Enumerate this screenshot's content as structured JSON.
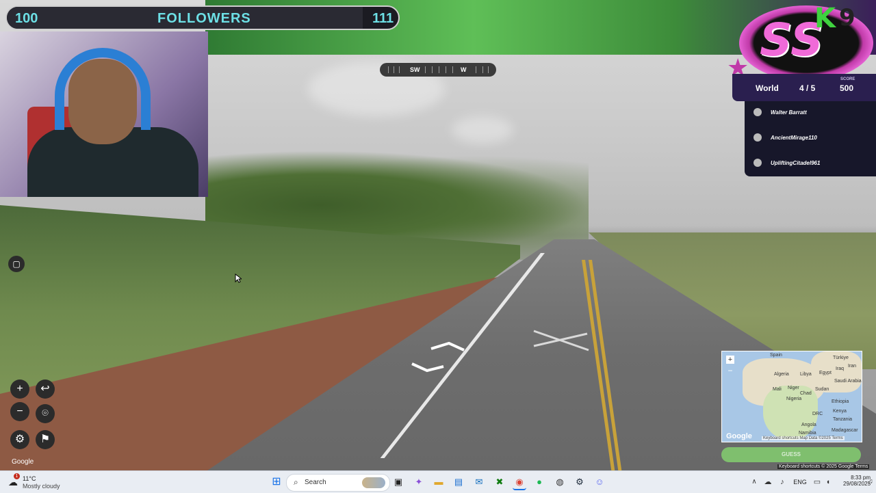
{
  "overlay": {
    "followers": {
      "current": "100",
      "label": "FOLLOWERS",
      "goal": "111"
    },
    "compass": {
      "left_dir": "SW",
      "right_dir": "W"
    },
    "logo": {
      "letters": "SS",
      "k": "K",
      "nine": "9"
    },
    "scoreboard": {
      "mode": "World",
      "round": "4 / 5",
      "score_label": "SCORE",
      "score": "500",
      "players": [
        "Walter Barratt",
        "AncientMirage110",
        "UpliftingCitadel961"
      ]
    }
  },
  "map_controls": {
    "zoom_in": "+",
    "zoom_out": "−",
    "undo": "↩",
    "google_mark": "Google"
  },
  "minimap": {
    "labels": [
      "Spain",
      "Türkiye",
      "Iraq",
      "Iran",
      "Algeria",
      "Libya",
      "Egypt",
      "Saudi Arabia",
      "Mali",
      "Niger",
      "Chad",
      "Sudan",
      "Nigeria",
      "Ethiopia",
      "DRC",
      "Kenya",
      "Tanzania",
      "Angola",
      "Namibia",
      "Madagascar"
    ],
    "google": "Google",
    "footer": "Keyboard shortcuts  Map Data ©2025  Terms",
    "guess_button": "GUESS"
  },
  "attribution": "Keyboard shortcuts  © 2025 Google  Terms",
  "taskbar": {
    "weather_temp": "11°C",
    "weather_desc": "Mostly cloudy",
    "notification_count": "1",
    "search_placeholder": "Search",
    "language": "ENG",
    "time": "8:33 pm",
    "date": "29/08/2025"
  },
  "colors": {
    "accent_cyan": "#6de0e6",
    "logo_pink": "#f06ad8",
    "scoreboard_purple": "#2a1f4f"
  }
}
